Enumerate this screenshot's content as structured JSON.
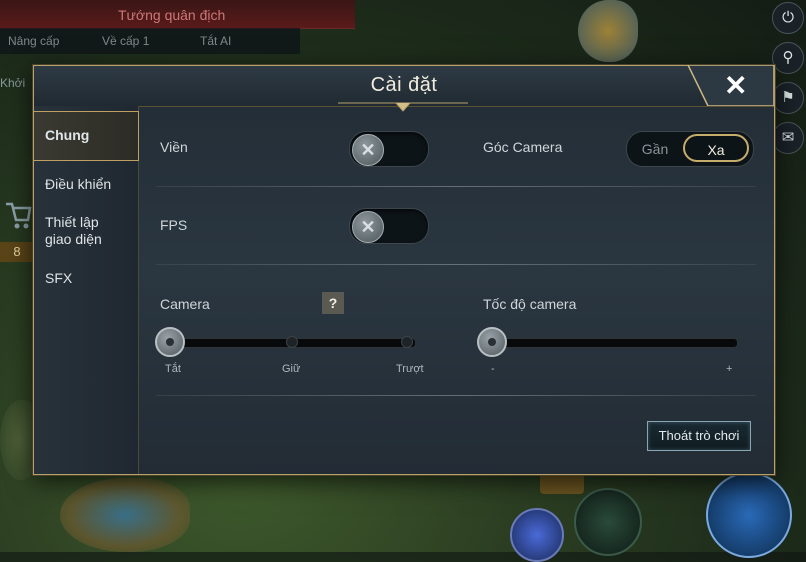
{
  "background": {
    "top_title": "Tướng quân địch",
    "buttons": [
      "Nâng cấp",
      "Về cấp 1",
      "Tắt AI"
    ],
    "row3_label": "Khởi",
    "cart_count": "8"
  },
  "dialog": {
    "title": "Cài đặt",
    "close_icon": "close-icon"
  },
  "sidebar": {
    "items": [
      {
        "label": "Chung",
        "active": true
      },
      {
        "label": "Điều khiển",
        "active": false
      },
      {
        "label": "Thiết lập giao diện",
        "active": false
      },
      {
        "label": "SFX",
        "active": false
      }
    ]
  },
  "settings": {
    "vien": {
      "label": "Viền",
      "state": "off"
    },
    "camera_angle": {
      "label": "Góc Camera",
      "options": [
        "Gần",
        "Xa"
      ],
      "selected": "Xa"
    },
    "fps": {
      "label": "FPS",
      "state": "off"
    },
    "camera": {
      "label": "Camera",
      "help": "?",
      "ticks": [
        "Tắt",
        "Giữ",
        "Trượt"
      ],
      "selected": "Tắt"
    },
    "camera_speed": {
      "label": "Tốc độ camera",
      "min_label": "-",
      "max_label": "+",
      "value": 0
    }
  },
  "exit_button": {
    "label": "Thoát trò chơi"
  },
  "colors": {
    "accent_gold": "#c7ad6b",
    "panel": "#27323c",
    "text": "#cfd6da"
  }
}
